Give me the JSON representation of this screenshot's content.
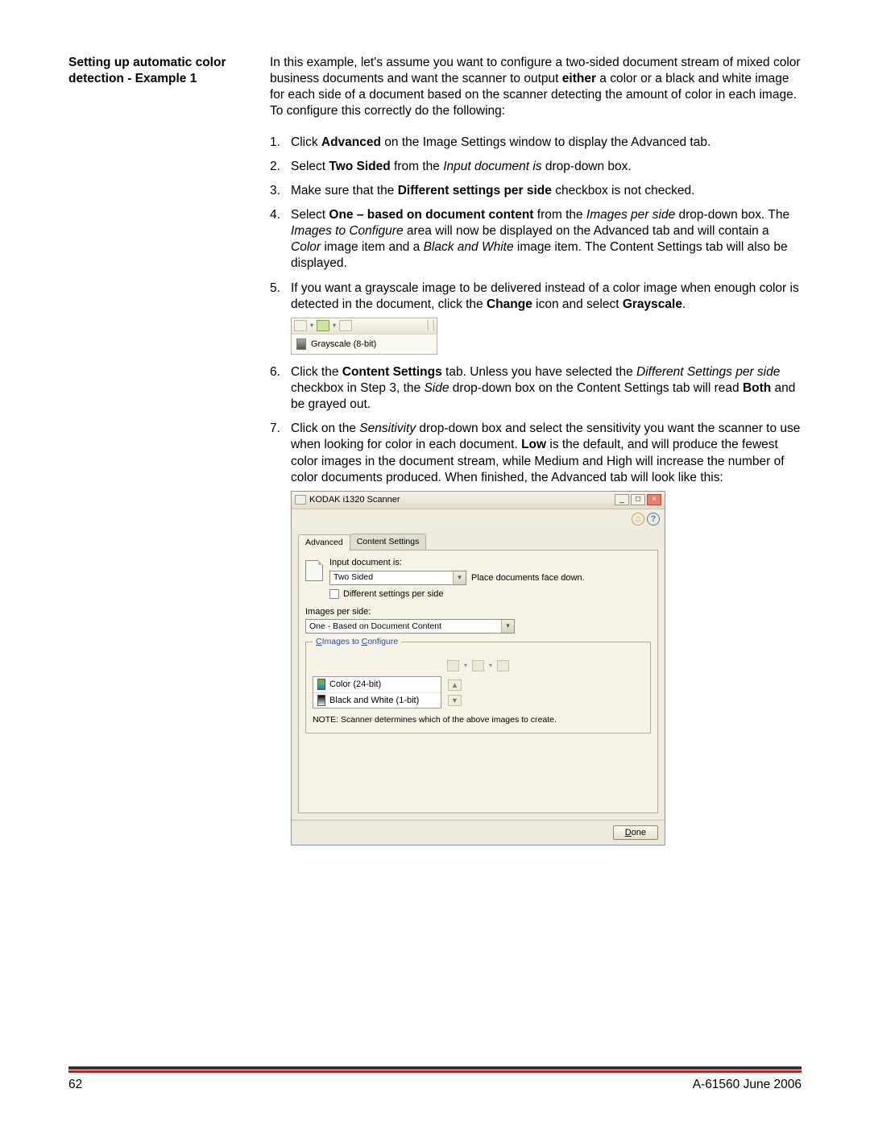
{
  "heading": "Setting up automatic color detection - Example 1",
  "intro": {
    "p1a": "In this example, let's assume you want to configure a two-sided document stream of mixed color business documents and want the scanner to output ",
    "p1b": "either",
    "p1c": " a color or a black and white image for each side of a document based on the scanner detecting the amount of color in each image. To configure this correctly do the following:"
  },
  "steps": {
    "s1a": "Click ",
    "s1b": "Advanced",
    "s1c": " on the Image Settings window to display the Advanced tab.",
    "s2a": "Select ",
    "s2b": "Two Sided",
    "s2c": " from the ",
    "s2d": "Input document is",
    "s2e": " drop-down box.",
    "s3a": "Make sure that the ",
    "s3b": "Different settings per side",
    "s3c": " checkbox is not checked.",
    "s4a": "Select ",
    "s4b": "One – based on document content",
    "s4c": " from the ",
    "s4d": "Images per side",
    "s4e": " drop-down box. The ",
    "s4f": "Images to Configure",
    "s4g": " area will now be displayed on the Advanced tab and will contain a ",
    "s4h": "Color",
    "s4i": " image item and a ",
    "s4j": "Black and White",
    "s4k": " image item. The Content Settings tab will also be displayed.",
    "s5a": "If you want a grayscale image to be delivered instead of a color image when enough color is detected in the document, click the ",
    "s5b": "Change",
    "s5c": " icon and select ",
    "s5d": "Grayscale",
    "s5e": ".",
    "s6a": "Click the ",
    "s6b": "Content Settings",
    "s6c": " tab. Unless you have selected the ",
    "s6d": "Different Settings per side",
    "s6e": " checkbox in Step 3, the ",
    "s6f": "Side",
    "s6g": " drop-down box on the Content Settings tab will read ",
    "s6h": "Both",
    "s6i": " and be grayed out.",
    "s7a": "Click on the ",
    "s7b": "Sensitivity",
    "s7c": " drop-down box and select the sensitivity you want the scanner to use when looking for color in each document. ",
    "s7d": "Low",
    "s7e": " is the default, and will produce the fewest color images in the document stream, while Medium and High will increase the number of color documents produced. When finished, the Advanced tab will look like this:"
  },
  "grayMenu": {
    "item": "Grayscale (8-bit)"
  },
  "scanner": {
    "title": "KODAK i1320 Scanner",
    "tabs": {
      "advanced": "Advanced",
      "content": "Content Settings"
    },
    "inputLbl": "Input document is:",
    "inputVal": "Two Sided",
    "placeHint": "Place documents face down.",
    "diffSide": "Different settings per side",
    "imagesPerSideLbl": "Images per side:",
    "imagesPerSideVal": "One - Based on Document Content",
    "legend": "Images to Configure",
    "item1": "Color (24-bit)",
    "item2": "Black and White (1-bit)",
    "note": "NOTE: Scanner determines which of the above images to create.",
    "done": "one",
    "doneU": "D"
  },
  "footer": {
    "page": "62",
    "doc": "A-61560  June 2006"
  }
}
